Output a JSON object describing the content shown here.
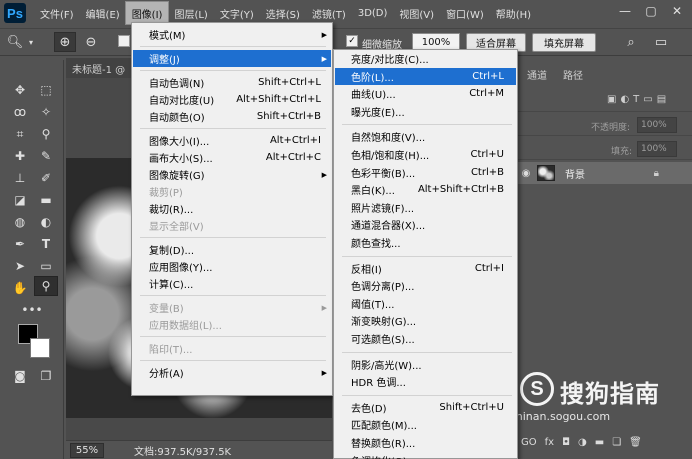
{
  "app": {
    "logo": "Ps"
  },
  "menubar": {
    "items": [
      "文件(F)",
      "编辑(E)",
      "图像(I)",
      "图层(L)",
      "文字(Y)",
      "选择(S)",
      "滤镜(T)",
      "3D(D)",
      "视图(V)",
      "窗口(W)",
      "帮助(H)"
    ],
    "active_index": 2
  },
  "window_buttons": {
    "minimize": "—",
    "maximize": "▢",
    "close": "✕"
  },
  "options": {
    "fine_zoom_label": "细微缩放",
    "zoom_value": "100%",
    "fit_screen": "适合屏幕",
    "fill_screen": "填充屏幕"
  },
  "document": {
    "tab_title": "未标题-1 @",
    "zoom": "55%",
    "doc_info": "文档:937.5K/937.5K"
  },
  "panels": {
    "tabs": [
      "通道",
      "路径"
    ],
    "opacity_label": "不透明度:",
    "opacity_value": "100%",
    "fill_label": "填充:",
    "fill_value": "100%",
    "layer_name": "背景",
    "bottom_icons": [
      "GO",
      "fx"
    ]
  },
  "image_menu": {
    "items": [
      {
        "label": "模式(M)",
        "shortcut": "",
        "submenu": true,
        "disabled": false
      },
      {
        "sep": true
      },
      {
        "label": "调整(J)",
        "shortcut": "",
        "submenu": true,
        "disabled": false,
        "highlight": true
      },
      {
        "sep": true
      },
      {
        "label": "自动色调(N)",
        "shortcut": "Shift+Ctrl+L"
      },
      {
        "label": "自动对比度(U)",
        "shortcut": "Alt+Shift+Ctrl+L"
      },
      {
        "label": "自动颜色(O)",
        "shortcut": "Shift+Ctrl+B"
      },
      {
        "sep": true
      },
      {
        "label": "图像大小(I)...",
        "shortcut": "Alt+Ctrl+I"
      },
      {
        "label": "画布大小(S)...",
        "shortcut": "Alt+Ctrl+C"
      },
      {
        "label": "图像旋转(G)",
        "shortcut": "",
        "submenu": true
      },
      {
        "label": "裁剪(P)",
        "shortcut": "",
        "disabled": true
      },
      {
        "label": "裁切(R)...",
        "shortcut": ""
      },
      {
        "label": "显示全部(V)",
        "shortcut": "",
        "disabled": true
      },
      {
        "sep": true
      },
      {
        "label": "复制(D)...",
        "shortcut": ""
      },
      {
        "label": "应用图像(Y)...",
        "shortcut": ""
      },
      {
        "label": "计算(C)...",
        "shortcut": ""
      },
      {
        "sep": true
      },
      {
        "label": "变量(B)",
        "shortcut": "",
        "submenu": true,
        "disabled": true
      },
      {
        "label": "应用数据组(L)...",
        "shortcut": "",
        "disabled": true
      },
      {
        "sep": true
      },
      {
        "label": "陷印(T)...",
        "shortcut": "",
        "disabled": true
      },
      {
        "sep": true
      },
      {
        "label": "分析(A)",
        "shortcut": "",
        "submenu": true
      }
    ]
  },
  "adjust_menu": {
    "items": [
      {
        "label": "亮度/对比度(C)...",
        "shortcut": ""
      },
      {
        "label": "色阶(L)...",
        "shortcut": "Ctrl+L",
        "highlight": true
      },
      {
        "label": "曲线(U)...",
        "shortcut": "Ctrl+M"
      },
      {
        "label": "曝光度(E)...",
        "shortcut": ""
      },
      {
        "sep": true
      },
      {
        "label": "自然饱和度(V)...",
        "shortcut": ""
      },
      {
        "label": "色相/饱和度(H)...",
        "shortcut": "Ctrl+U"
      },
      {
        "label": "色彩平衡(B)...",
        "shortcut": "Ctrl+B"
      },
      {
        "label": "黑白(K)...",
        "shortcut": "Alt+Shift+Ctrl+B"
      },
      {
        "label": "照片滤镜(F)...",
        "shortcut": ""
      },
      {
        "label": "通道混合器(X)...",
        "shortcut": ""
      },
      {
        "label": "颜色查找...",
        "shortcut": ""
      },
      {
        "sep": true
      },
      {
        "label": "反相(I)",
        "shortcut": "Ctrl+I"
      },
      {
        "label": "色调分离(P)...",
        "shortcut": ""
      },
      {
        "label": "阈值(T)...",
        "shortcut": ""
      },
      {
        "label": "渐变映射(G)...",
        "shortcut": ""
      },
      {
        "label": "可选颜色(S)...",
        "shortcut": ""
      },
      {
        "sep": true
      },
      {
        "label": "阴影/高光(W)...",
        "shortcut": ""
      },
      {
        "label": "HDR 色调...",
        "shortcut": ""
      },
      {
        "sep": true
      },
      {
        "label": "去色(D)",
        "shortcut": "Shift+Ctrl+U"
      },
      {
        "label": "匹配颜色(M)...",
        "shortcut": ""
      },
      {
        "label": "替换颜色(R)...",
        "shortcut": ""
      },
      {
        "label": "色调均化(Q)",
        "shortcut": ""
      }
    ]
  },
  "watermark": {
    "logo_letter": "S",
    "text": "搜狗指南",
    "url": "zhinan.sogou.com"
  },
  "colors": {
    "highlight": "#1e6fd0",
    "menu_bg": "#f0f0f0",
    "ui_bg": "#535353"
  }
}
